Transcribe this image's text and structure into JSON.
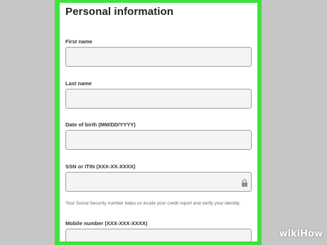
{
  "form": {
    "title": "Personal information",
    "fields": [
      {
        "label": "First name",
        "value": ""
      },
      {
        "label": "Last name",
        "value": ""
      },
      {
        "label": "Date of birth (MM/DD/YYYY)",
        "value": ""
      },
      {
        "label": "SSN or ITIN (XXX-XX-XXXX)",
        "value": ""
      },
      {
        "label": "Mobile number (XXX-XXX-XXXX)",
        "value": ""
      }
    ],
    "ssn_help": "Your Social Security number helps us locate your credit report and verify your identity.",
    "ssn_icon": "lock-icon"
  },
  "watermark": {
    "wiki": "wiki",
    "how": "How"
  },
  "colors": {
    "highlight_frame": "#3de33d",
    "background": "#c6c6c6"
  }
}
